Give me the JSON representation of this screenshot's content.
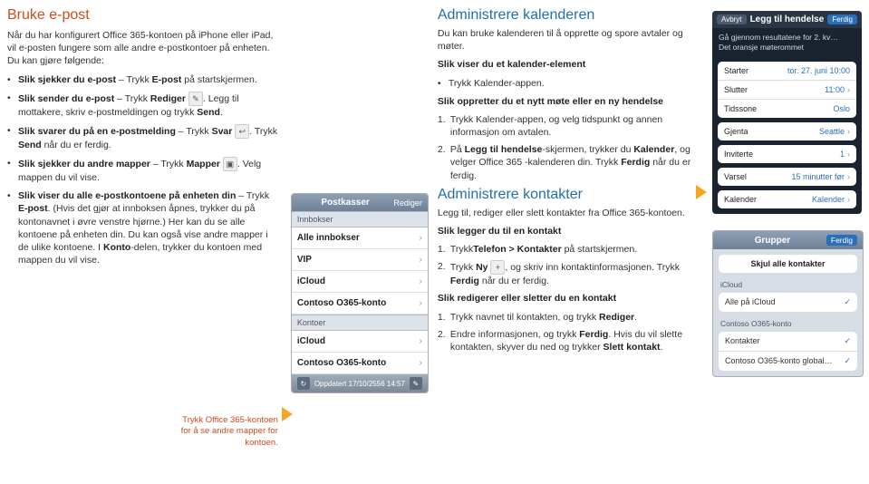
{
  "left": {
    "title": "Bruke e-post",
    "intro": "Når du har konfigurert Office 365-kontoen på iPhone eller iPad, vil e-posten fungere som alle andre e-postkontoer på enheten. Du kan gjøre følgende:",
    "b1a": "Slik sjekker du e-post",
    "b1b": " – Trykk ",
    "b1c": "E-post",
    "b1d": " på startskjermen.",
    "b2a": "Slik sender du e-post",
    "b2b": " – Trykk ",
    "b2c": "Rediger ",
    "b2d": ". Legg til mottakere, skriv e-postmeldingen og trykk ",
    "b2e": "Send",
    "dot": ".",
    "b3a": "Slik svarer du på en e-postmelding",
    "b3b": " – Trykk ",
    "b3c": "Svar ",
    "b3d": ". Trykk ",
    "b3e": "Send",
    "b3f": " når du er ferdig.",
    "b4a": "Slik sjekker du andre mapper",
    "b4b": " – Trykk ",
    "b4c": "Mapper ",
    "b4d": ". Velg mappen du vil vise.",
    "b5a": "Slik viser du alle e-postkontoene på enheten din",
    "b5b": " – Trykk ",
    "b5c": "E-post",
    "b5d": ". (Hvis det gjør at innboksen åpnes, trykker du på kontonavnet i øvre venstre hjørne.) Her kan du se alle kontoene på enheten din. Du kan også vise andre mapper i de ulike kontoene. I ",
    "b5e": "Konto",
    "b5f": "-delen, trykker du kontoen med mappen du vil vise.",
    "caption": "Trykk Office 365-kontoen for å se andre mapper for kontoen."
  },
  "phone": {
    "title": "Postkasser",
    "edit": "Rediger",
    "sect1": "Innbokser",
    "r1": "Alle innbokser",
    "r2": "VIP",
    "r3": "iCloud",
    "r4": "Contoso O365-konto",
    "sect2": "Kontoer",
    "r5": "iCloud",
    "r6": "Contoso O365-konto",
    "foot": "Oppdatert 17/10/2556 14:57"
  },
  "mid": {
    "title1": "Administrere kalenderen",
    "p1": "Du kan bruke kalenderen til å opprette og spore avtaler og møter.",
    "h1": "Slik viser du et kalender-element",
    "b1": "Trykk Kalender-appen.",
    "h2": "Slik oppretter du et nytt møte eller en ny hendelse",
    "n1": "Trykk Kalender-appen, og velg tidspunkt og annen informasjon om avtalen.",
    "n2a": "På ",
    "n2b": "Legg til hendelse",
    "n2c": "-skjermen, trykker du ",
    "n2d": "Kalender",
    "n2e": ", og velger Office 365 -kalenderen din. Trykk ",
    "n2f": "Ferdig",
    "n2g": " når du er ferdig.",
    "title2": "Administrere kontakter",
    "p2": "Legg til, rediger eller slett kontakter fra Office 365-kontoen.",
    "h3": "Slik legger du til en kontakt",
    "c1a": "Trykk",
    "c1b": "Telefon > Kontakter",
    "c1c": " på startskjermen.",
    "c2a": "Trykk ",
    "c2b": "Ny ",
    "c2c": ", og skriv inn kontaktinformasjonen. Trykk ",
    "c2d": "Ferdig",
    "c2e": " når du er ferdig.",
    "h4": "Slik redigerer eller sletter du en kontakt",
    "d1a": "Trykk navnet til kontakten, og trykk ",
    "d1b": "Rediger",
    "d2a": "Endre informasjonen, og trykk ",
    "d2b": "Ferdig",
    "d2c": ". Hvis du vil slette kontakten, skyver du ned og trykker ",
    "d2d": "Slett kontakt"
  },
  "evt": {
    "cancel": "Avbryt",
    "title": "Legg til hendelse",
    "done": "Ferdig",
    "info1": "Gå gjennom resultatene for 2. kv…",
    "info2": "Det oransje møterommet",
    "start_l": "Starter",
    "start_v": "tor. 27. juni 10:00",
    "end_l": "Slutter",
    "end_v": "11:00",
    "tz_l": "Tidssone",
    "tz_v": "Oslo",
    "rep_l": "Gjenta",
    "rep_v": "Seattle",
    "inv_l": "Inviterte",
    "inv_v": "1",
    "alert_l": "Varsel",
    "alert_v": "15 minutter før",
    "cal_l": "Kalender",
    "cal_v": "Kalender"
  },
  "grp": {
    "title": "Grupper",
    "done": "Ferdig",
    "hide": "Skjul alle kontakter",
    "s1": "iCloud",
    "g1": "Alle på iCloud",
    "s2": "Contoso O365-konto",
    "g2": "Kontakter",
    "g3": "Contoso O365-konto global…"
  },
  "nums": {
    "n1": "1.",
    "n2": "2."
  },
  "chev": "›",
  "check": "✓",
  "plus": "+",
  "refresh": "↻",
  "compose": "✎",
  "reply": "↩",
  "folder": "▣"
}
